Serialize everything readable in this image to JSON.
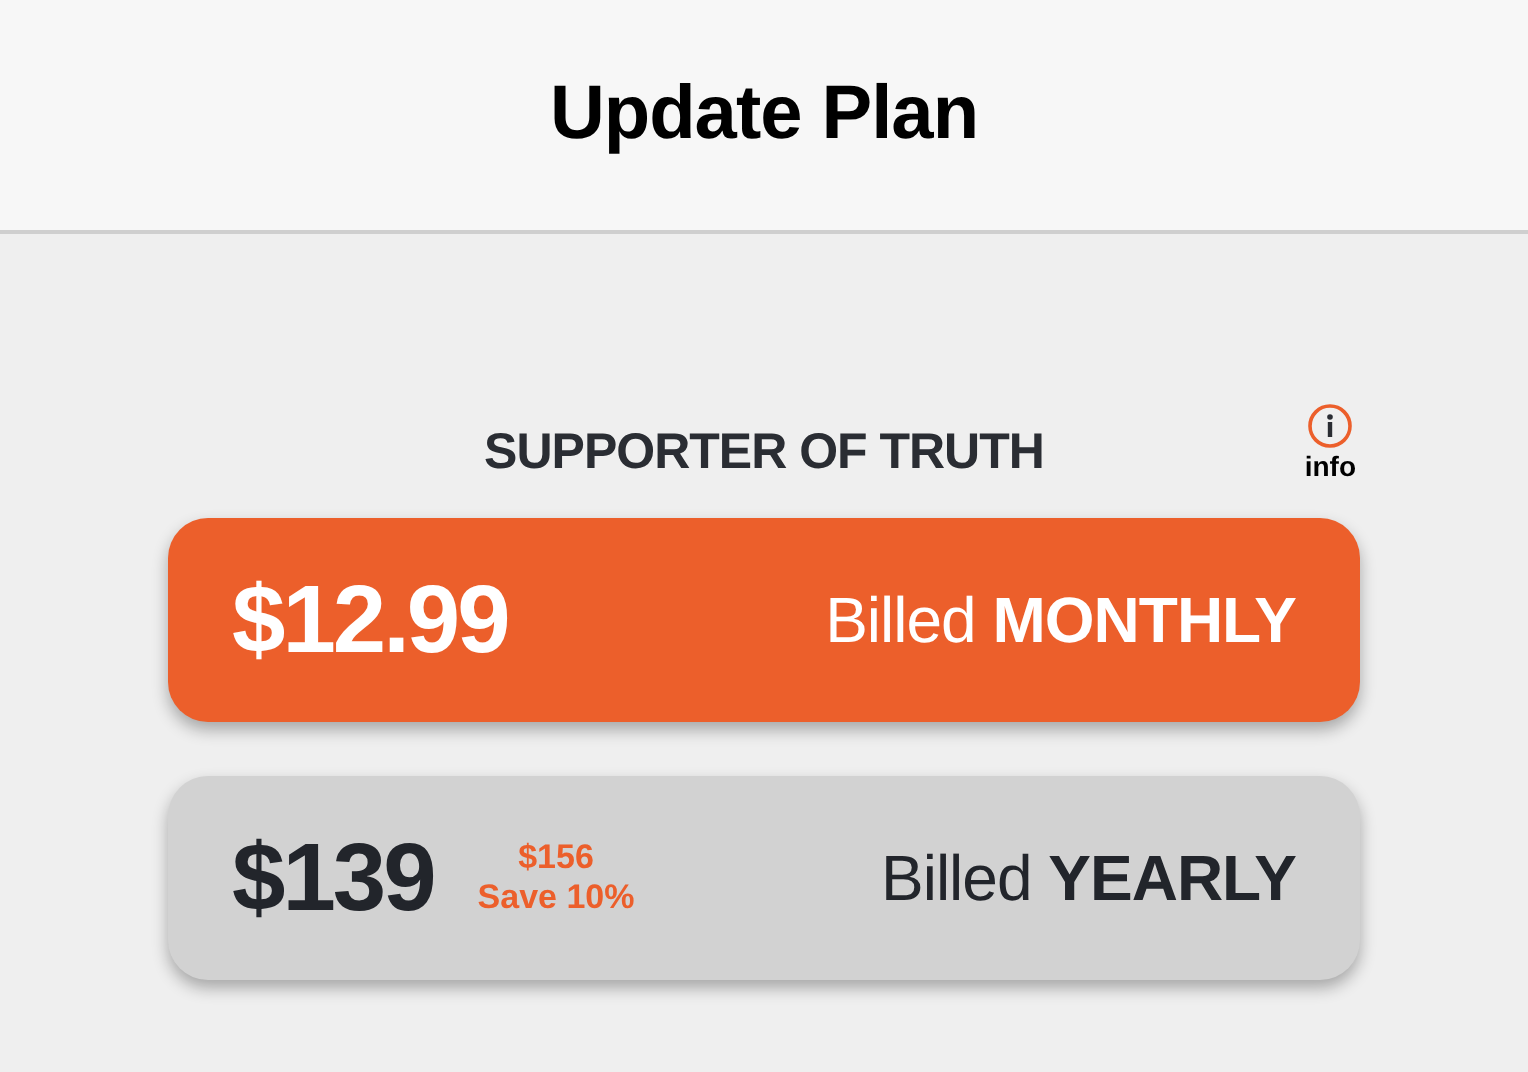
{
  "header": {
    "title": "Update Plan"
  },
  "plan": {
    "name": "SUPPORTER OF TRUTH",
    "info_label": "info"
  },
  "options": [
    {
      "price": "$12.99",
      "billing": "Billed **MONTHLY**",
      "selected": true
    },
    {
      "price": "$139",
      "original_price": "$156",
      "savings": "Save 10%",
      "billing": "Billed **YEARLY**",
      "selected": false
    }
  ]
}
